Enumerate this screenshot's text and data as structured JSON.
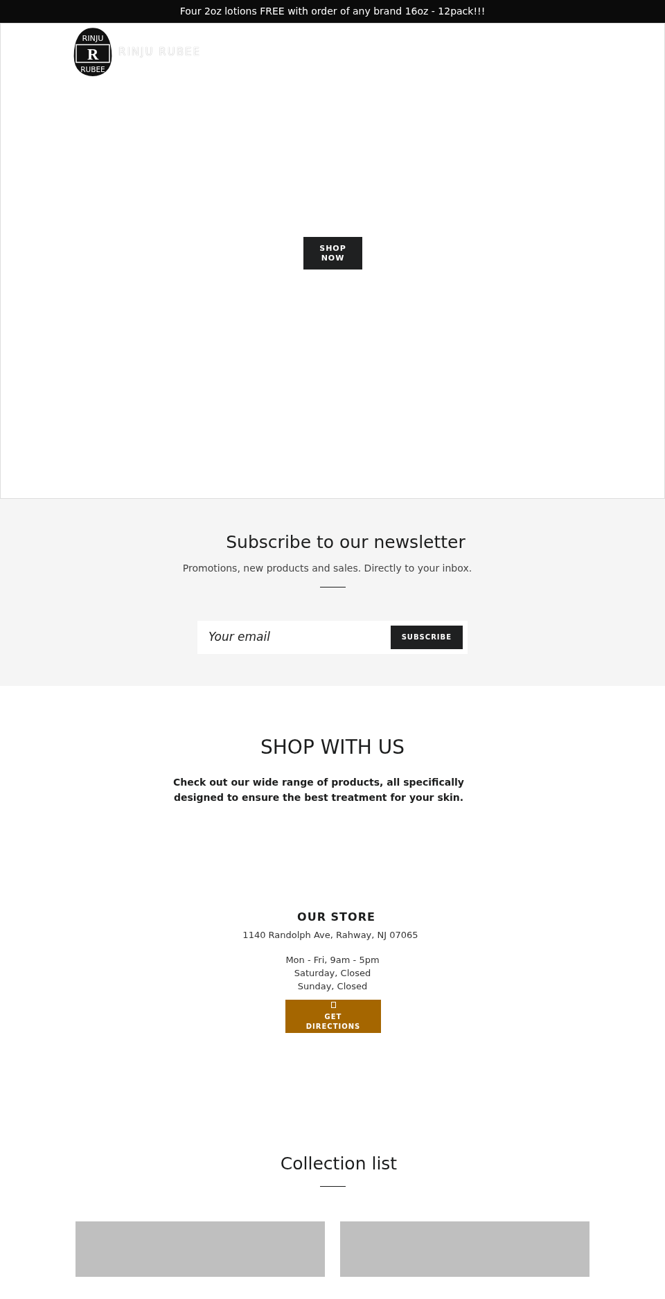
{
  "announcement": "Four 2oz lotions FREE with order of any brand 16oz - 12pack!!!",
  "logo": {
    "badge_top": "RINJU",
    "badge_letter": "R",
    "badge_bottom": "RUBEE",
    "wordmark": "RINJU RUBEE"
  },
  "hero": {
    "button": "SHOP NOW"
  },
  "newsletter": {
    "title": "Subscribe to our newsletter",
    "subtitle": "Promotions, new products and sales. Directly to your inbox.",
    "placeholder": "Your email",
    "button": "SUBSCRIBE"
  },
  "shop_with_us": {
    "title": "SHOP WITH US",
    "text": "Check out our wide range of products, all specifically designed to ensure the best treatment for your skin."
  },
  "store": {
    "title": "OUR STORE",
    "address": "1140 Randolph Ave, Rahway, NJ 07065",
    "hours": [
      "Mon - Fri, 9am - 5pm",
      "Saturday, Closed",
      "Sunday, Closed"
    ],
    "button": "GET DIRECTIONS"
  },
  "collection_list": {
    "title": "Collection list",
    "cards": [
      {
        "kind": "placeholder"
      },
      {
        "kind": "placeholder"
      }
    ]
  }
}
